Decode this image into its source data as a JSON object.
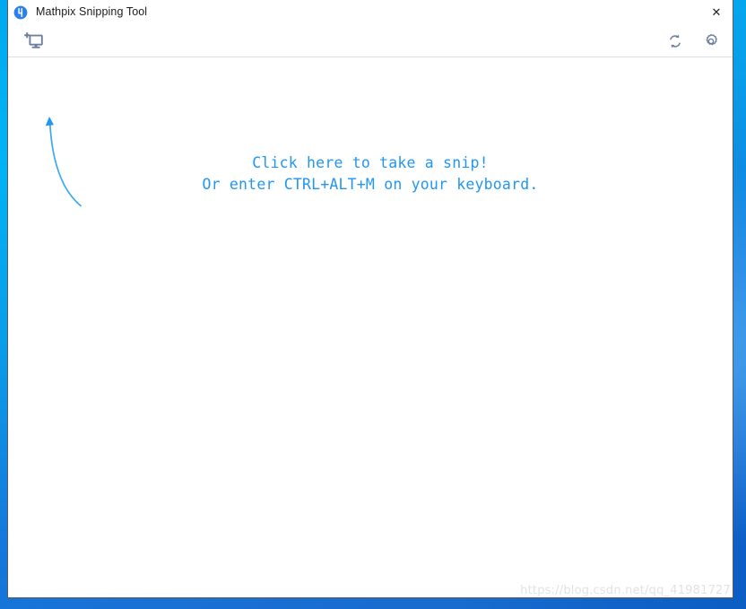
{
  "window": {
    "title": "Mathpix Snipping Tool",
    "logo_icon": "mathpix-logo-icon",
    "close_label": "✕"
  },
  "toolbar": {
    "snip_icon": "new-snip-monitor-icon",
    "snip_tooltip": "New snip",
    "sync_icon": "sync-refresh-icon",
    "sync_tooltip": "Sync",
    "settings_icon": "gear-settings-icon",
    "settings_tooltip": "Settings"
  },
  "content": {
    "arrow_icon": "curved-hint-arrow-icon",
    "hint_line_1": "Click here to take a snip!",
    "hint_line_2": "Or enter CTRL+ALT+M on your keyboard.",
    "watermark": "https://blog.csdn.net/qq_41981727"
  },
  "colors": {
    "accent_blue": "#2196f3",
    "logo_blue": "#2d7ff0",
    "icon_gray_blue": "#6b7a9b",
    "desktop_blue": "#00a8f0",
    "watermark_gray": "#e2e2e2"
  }
}
